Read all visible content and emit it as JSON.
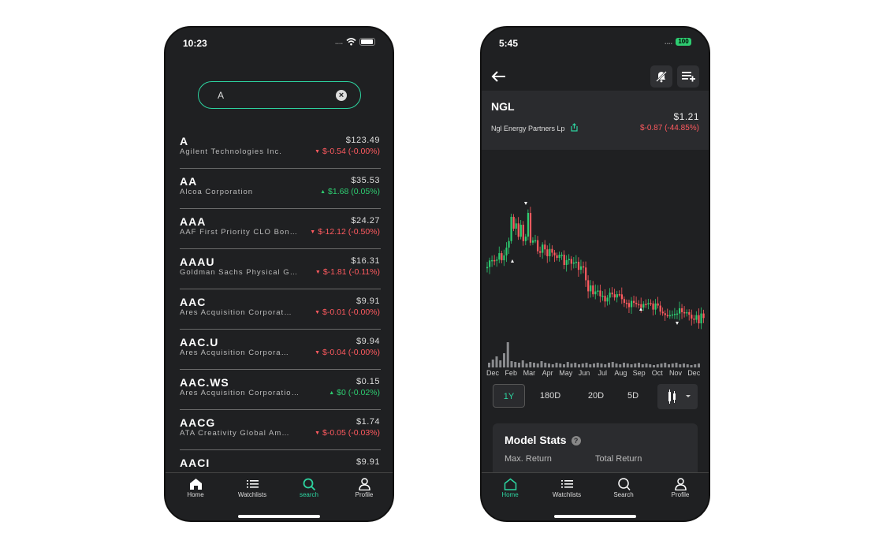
{
  "search_screen": {
    "status_time": "10:23",
    "search_value": "A",
    "results": [
      {
        "symbol": "A",
        "name": "Agilent Technologies Inc.",
        "price": "$123.49",
        "change": "$-0.54 (-0.00%)",
        "direction": "down"
      },
      {
        "symbol": "AA",
        "name": "Alcoa Corporation",
        "price": "$35.53",
        "change": "$1.68 (0.05%)",
        "direction": "up"
      },
      {
        "symbol": "AAA",
        "name": "AAF First Priority CLO Bon…",
        "price": "$24.27",
        "change": "$-12.12 (-0.50%)",
        "direction": "down"
      },
      {
        "symbol": "AAAU",
        "name": "Goldman Sachs Physical G…",
        "price": "$16.31",
        "change": "$-1.81 (-0.11%)",
        "direction": "down"
      },
      {
        "symbol": "AAC",
        "name": "Ares Acquisition Corporat…",
        "price": "$9.91",
        "change": "$-0.01 (-0.00%)",
        "direction": "down"
      },
      {
        "symbol": "AAC.U",
        "name": "Ares Acquisition Corpora…",
        "price": "$9.94",
        "change": "$-0.04 (-0.00%)",
        "direction": "down"
      },
      {
        "symbol": "AAC.WS",
        "name": "Ares Acquisition Corporation…",
        "price": "$0.15",
        "change": "$0 (-0.02%)",
        "direction": "up"
      },
      {
        "symbol": "AACG",
        "name": "ATA Creativity Global Am…",
        "price": "$1.74",
        "change": "$-0.05 (-0.03%)",
        "direction": "down"
      },
      {
        "symbol": "AACI",
        "name": "",
        "price": "$9.91",
        "change": "",
        "direction": "down"
      }
    ],
    "tabs": {
      "home": "Home",
      "watchlists": "Watchlists",
      "search": "search",
      "profile": "Profile"
    }
  },
  "detail_screen": {
    "status_time": "5:45",
    "battery": "100",
    "ticker": "NGL",
    "company": "Ngl Energy Partners Lp",
    "price": "$1.21",
    "change": "$-0.87 (-44.85%)",
    "months": [
      "Dec",
      "Feb",
      "Mar",
      "Apr",
      "May",
      "Jun",
      "Jul",
      "Aug",
      "Sep",
      "Oct",
      "Nov",
      "Dec"
    ],
    "ranges": [
      "1Y",
      "180D",
      "20D",
      "5D"
    ],
    "active_range": "1Y",
    "model_stats_title": "Model Stats",
    "stat_headers": [
      "Max. Return",
      "Total Return"
    ],
    "tabs": {
      "home": "Home",
      "watchlists": "Watchlists",
      "search": "Search",
      "profile": "Profile"
    }
  },
  "colors": {
    "accent": "#2dd4a0",
    "negative": "#ff5a5f",
    "positive": "#2ecc71",
    "background": "#1f2022"
  }
}
